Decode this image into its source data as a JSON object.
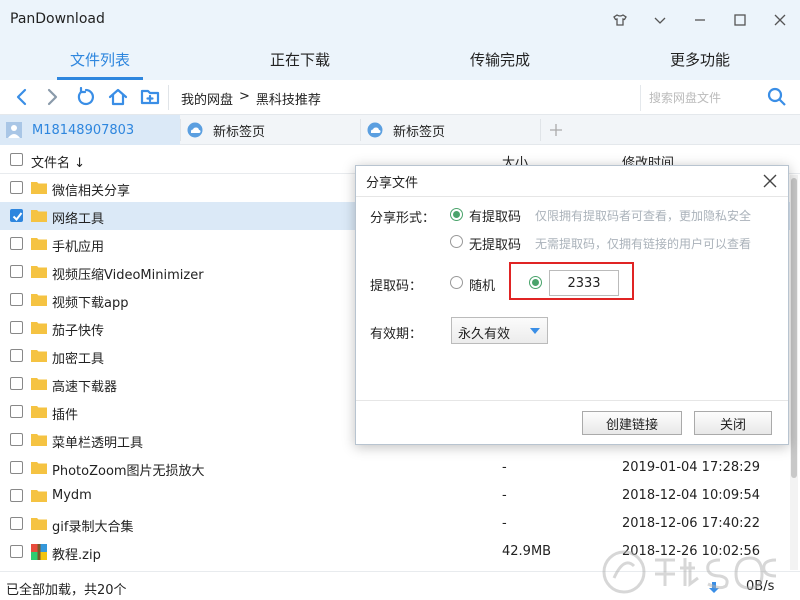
{
  "app": {
    "title": "PanDownload"
  },
  "main_tabs": [
    {
      "label": "文件列表",
      "active": true
    },
    {
      "label": "正在下载",
      "active": false
    },
    {
      "label": "传输完成",
      "active": false
    },
    {
      "label": "更多功能",
      "active": false
    }
  ],
  "toolbar": {
    "breadcrumb": [
      "我的网盘",
      ">",
      "黑科技推荐"
    ],
    "search_placeholder": "搜索网盘文件"
  },
  "account_tabs": [
    {
      "label": "M18148907803",
      "icon": "user-icon",
      "active": true
    },
    {
      "label": "新标签页",
      "icon": "cloud-icon",
      "active": false
    },
    {
      "label": "新标签页",
      "icon": "cloud-icon",
      "active": false
    }
  ],
  "list": {
    "headers": {
      "name": "文件名",
      "sort_arrow": "↓",
      "size": "大小",
      "time": "修改时间"
    },
    "rows": [
      {
        "name": "微信相关分享",
        "type": "folder",
        "size": "",
        "time": "",
        "checked": false
      },
      {
        "name": "网络工具",
        "type": "folder",
        "size": "",
        "time": "",
        "checked": true
      },
      {
        "name": "手机应用",
        "type": "folder",
        "size": "",
        "time": "",
        "checked": false
      },
      {
        "name": "视频压缩VideoMinimizer",
        "type": "folder",
        "size": "",
        "time": "",
        "checked": false
      },
      {
        "name": "视频下载app",
        "type": "folder",
        "size": "",
        "time": "",
        "checked": false
      },
      {
        "name": "茄子快传",
        "type": "folder",
        "size": "",
        "time": "",
        "checked": false
      },
      {
        "name": "加密工具",
        "type": "folder",
        "size": "",
        "time": "",
        "checked": false
      },
      {
        "name": "高速下载器",
        "type": "folder",
        "size": "",
        "time": "",
        "checked": false
      },
      {
        "name": "插件",
        "type": "folder",
        "size": "",
        "time": "",
        "checked": false
      },
      {
        "name": "菜单栏透明工具",
        "type": "folder",
        "size": "",
        "time": "",
        "checked": false
      },
      {
        "name": "PhotoZoom图片无损放大",
        "type": "folder",
        "size": "-",
        "time": "2019-01-04 17:28:29",
        "checked": false
      },
      {
        "name": "Mydm",
        "type": "folder",
        "size": "-",
        "time": "2018-12-04 10:09:54",
        "checked": false
      },
      {
        "name": "gif录制大合集",
        "type": "folder",
        "size": "-",
        "time": "2018-12-06 17:40:22",
        "checked": false
      },
      {
        "name": "教程.zip",
        "type": "zip",
        "size": "42.9MB",
        "time": "2018-12-26 10:02:56",
        "checked": false
      }
    ]
  },
  "status": {
    "text": "已全部加载，共20个",
    "speed": "0B/s"
  },
  "dialog": {
    "title": "分享文件",
    "share_type_label": "分享形式：",
    "option_with_code": "有提取码",
    "option_with_code_hint": "仅限拥有提取码者可查看，更加隐私安全",
    "option_no_code": "无提取码",
    "option_no_code_hint": "无需提取码，仅拥有链接的用户可以查看",
    "code_label": "提取码：",
    "random_label": "随机",
    "code_value": "2333",
    "validity_label": "有效期：",
    "validity_value": "永久有效",
    "create_button": "创建链接",
    "close_button": "关闭"
  },
  "colors": {
    "accent": "#2e86de",
    "radio_green": "#4aa36b",
    "highlight_red": "#e02424",
    "folder": "#f5c342"
  }
}
